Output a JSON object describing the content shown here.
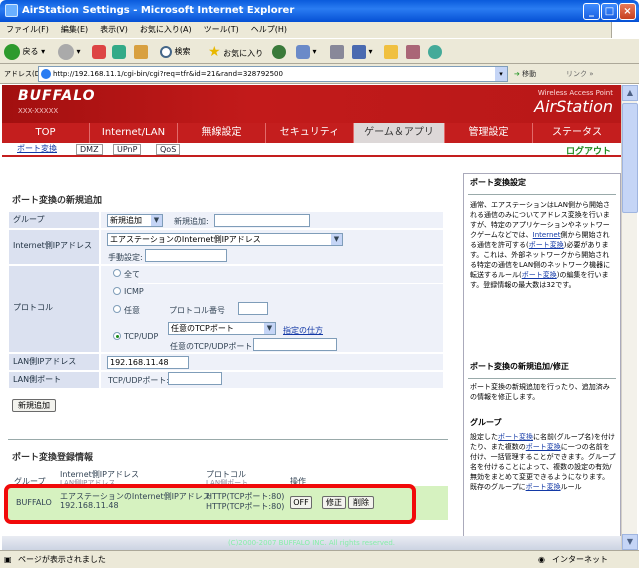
{
  "window": {
    "title": "AirStation Settings - Microsoft Internet Explorer"
  },
  "menu": [
    "ファイル(F)",
    "編集(E)",
    "表示(V)",
    "お気に入り(A)",
    "ツール(T)",
    "ヘルプ(H)"
  ],
  "toolbar": {
    "back": "戻る",
    "search": "検索",
    "favorites": "お気に入り"
  },
  "address": {
    "label": "アドレス(D)",
    "url": "http://192.168.11.1/cgi-bin/cgi?req=tfr&id=21&rand=328792500",
    "go": "移動",
    "links": "リンク"
  },
  "header": {
    "logo": "BUFFALO",
    "model": "XXX-XXXXX",
    "wap": "Wireless Access Point",
    "product": "AirStation"
  },
  "nav": [
    "TOP",
    "Internet/LAN",
    "無線設定",
    "セキュリティ",
    "ゲーム＆アプリ",
    "管理設定",
    "ステータス"
  ],
  "subnav": [
    "ポート変換",
    "DMZ",
    "UPnP",
    "QoS"
  ],
  "logout": "ログアウト",
  "form": {
    "title": "ポート変換の新規追加",
    "group_label": "グループ",
    "group_select": "新規追加",
    "group_new_label": "新規追加:",
    "inet_label": "Internet側IPアドレス",
    "inet_select": "エアステーションのInternet側IPアドレス",
    "manual_label": "手動設定:",
    "proto_label": "プロトコル",
    "proto_all": "全て",
    "proto_icmp": "ICMP",
    "proto_any": "任意",
    "proto_num_label": "プロトコル番号",
    "proto_tcpudp": "TCP/UDP",
    "port_select": "任意のTCPポート",
    "port_help": "指定の仕方",
    "port_input_label": "任意のTCP/UDPポート:",
    "lan_ip_label": "LAN側IPアドレス",
    "lan_ip_value": "192.168.11.48",
    "lan_port_label": "LAN側ポート",
    "lan_port_input_label": "TCP/UDPポート:",
    "add_button": "新規追加"
  },
  "reg": {
    "title": "ポート変換登録情報",
    "headers": [
      "グループ",
      "Internet側IPアドレス",
      "プロトコル",
      "操作"
    ],
    "subheaders": [
      "LAN側IPアドレス",
      "LAN側ポート"
    ],
    "row": {
      "group": "BUFFALO",
      "inet": "エアステーションのInternet側IPアドレス",
      "lan_ip": "192.168.11.48",
      "proto1": "HTTP(TCPポート:80)",
      "proto2": "HTTP(TCPポート:80)",
      "off": "OFF",
      "edit": "修正",
      "del": "削除"
    }
  },
  "help": {
    "t1": "ポート変換設定",
    "p1": "通常、エアステーションはLAN側から開始される通信のみについてアドレス変換を行いますが、特定のアプリケーションやネットワークゲームなどでは、",
    "p1link": "Internet",
    "p1b": "側から開始される通信を許可する(",
    "p1link2": "ポート変換",
    "p1c": ")必要があります。これは、外部ネットワークから開始される特定の通信をLAN側のネットワーク機器に転送するルール(",
    "p1link3": "ポート変換",
    "p1d": ")の編集を行います。登録情報の最大数は32です。",
    "t2": "ポート変換の新規追加/修正",
    "p2": "ポート変換の新規追加を行ったり、追加済みの情報を修正します。",
    "t3": "グループ",
    "p3a": "設定した",
    "p3link": "ポート変換",
    "p3b": "に名前(グループ名)を付けたり、また複数の",
    "p3link2": "ポート変換",
    "p3c": "に一つの名前を付け、一括管理することができます。グループ名を付けることによって、複数の設定の有効/無効をまとめて変更できるようになります。既存のグループに",
    "p3link3": "ポート変換",
    "p3d": "ルール"
  },
  "footer": "(C)2000-2007 BUFFALO INC. All rights reserved.",
  "status": {
    "text": "ページが表示されました",
    "zone": "インターネット"
  }
}
